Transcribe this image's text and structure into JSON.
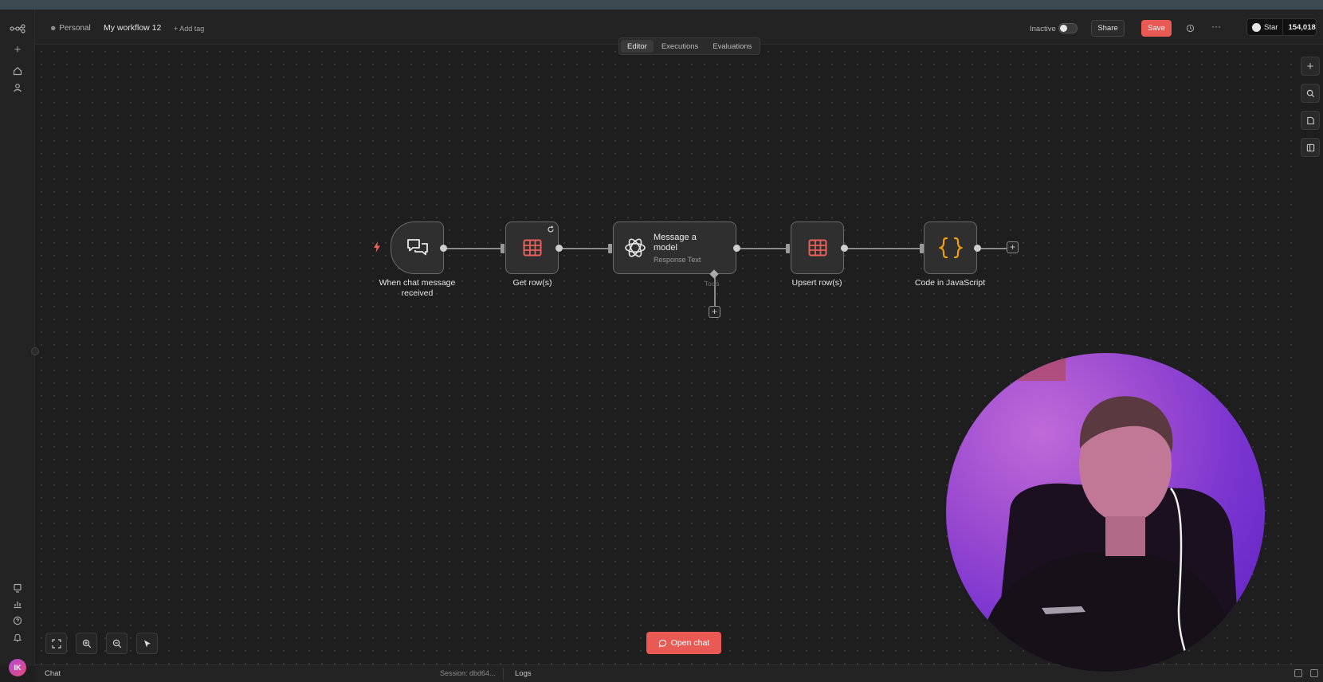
{
  "header": {
    "workspace": "Personal",
    "workflow_name": "My workflow 12",
    "add_tag": "+ Add tag",
    "status_label": "Inactive",
    "share_label": "Share",
    "save_label": "Save",
    "github_star_label": "Star",
    "github_star_count": "154,018"
  },
  "tabs": [
    {
      "label": "Editor",
      "active": true
    },
    {
      "label": "Executions",
      "active": false
    },
    {
      "label": "Evaluations",
      "active": false
    }
  ],
  "nodes": [
    {
      "id": "trigger",
      "label": "When chat message received",
      "icon": "chat-bubbles-icon"
    },
    {
      "id": "get-rows",
      "label": "Get row(s)",
      "icon": "table-icon"
    },
    {
      "id": "message-model",
      "title": "Message a model",
      "subtitle": "Response Text",
      "icon": "openai-icon",
      "tools_label": "Tools"
    },
    {
      "id": "upsert-rows",
      "label": "Upsert row(s)",
      "icon": "table-icon"
    },
    {
      "id": "code-js",
      "label": "Code in JavaScript",
      "icon": "curly-braces-icon"
    }
  ],
  "canvas_controls": {
    "open_chat_label": "Open chat"
  },
  "bottom_bar": {
    "chat_label": "Chat",
    "session_label": "Session: dbd64...",
    "logs_label": "Logs"
  },
  "user": {
    "avatar_initials": "IK"
  },
  "colors": {
    "accent": "#ea5a55",
    "table_icon": "#e8605a",
    "code_icon": "#f59e0b",
    "trigger_bolt": "#e8605a"
  }
}
